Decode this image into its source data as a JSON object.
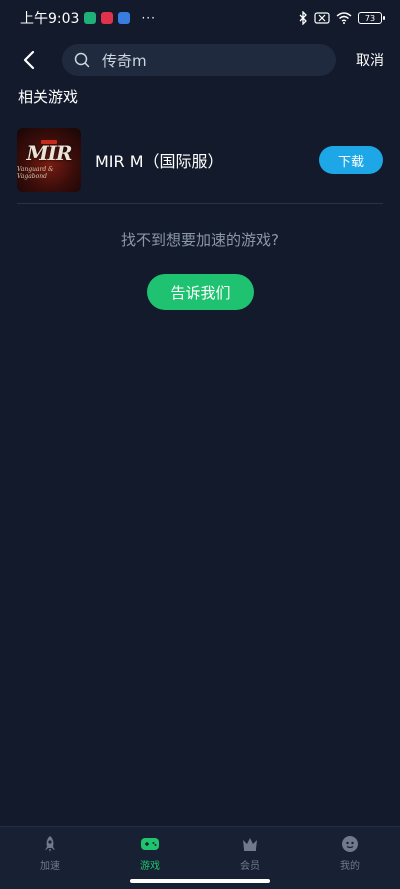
{
  "status_bar": {
    "time": "上午9:03",
    "dots": "···",
    "battery": "73"
  },
  "search": {
    "value": "传奇m",
    "cancel_label": "取消"
  },
  "section": {
    "title": "相关游戏"
  },
  "game": {
    "name": "MIR M（国际服）",
    "download_label": "下载",
    "icon_logo": "MIR",
    "icon_subtitle": "Vanguard & Vagabond"
  },
  "hint": {
    "text": "找不到想要加速的游戏?",
    "button_label": "告诉我们"
  },
  "nav": {
    "items": [
      {
        "label": "加速",
        "icon": "rocket-icon"
      },
      {
        "label": "游戏",
        "icon": "gamepad-icon"
      },
      {
        "label": "会员",
        "icon": "crown-icon"
      },
      {
        "label": "我的",
        "icon": "profile-icon"
      }
    ],
    "active_index": 1
  },
  "colors": {
    "background": "#121a2b",
    "accent_green": "#1fc270",
    "accent_blue": "#1ea7e6"
  }
}
